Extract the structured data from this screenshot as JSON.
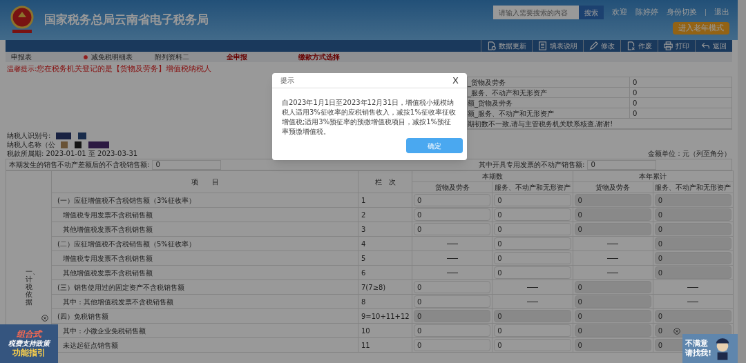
{
  "header": {
    "title": "国家税务总局云南省电子税务局",
    "search": {
      "placeholder": "请输入需要搜索的内容",
      "button": "搜索"
    },
    "links": [
      "欢迎",
      "陈婷婷",
      "身份切换",
      "退出"
    ],
    "elder_mode": "进入老年模式"
  },
  "toolbar": [
    {
      "kind": "refresh",
      "label": "数据更新"
    },
    {
      "kind": "doc",
      "label": "填表说明"
    },
    {
      "kind": "edit",
      "label": "修改"
    },
    {
      "kind": "void",
      "label": "作废"
    },
    {
      "kind": "print",
      "label": "打印"
    },
    {
      "kind": "back",
      "label": "返回"
    }
  ],
  "tabs": [
    {
      "label": "申报表",
      "kind": "plain"
    },
    {
      "label": "减免税明细表",
      "kind": "dot"
    },
    {
      "label": "附列资料二",
      "kind": "plain"
    },
    {
      "label": "全申报",
      "kind": "emphasis"
    },
    {
      "label": "缴款方式选择",
      "kind": "emphasis"
    }
  ],
  "notice": {
    "label": "温馨提示:",
    "text": "您在税务机关登记的是【货物及劳务】增值税纳税人"
  },
  "info_rows": [
    {
      "label": "_货物及劳务",
      "value": "0"
    },
    {
      "label": "_服务、不动产和无形资产",
      "value": "0"
    },
    {
      "label": "额_货物及劳务",
      "value": "0"
    },
    {
      "label": "额_服务、不动产和无形资产",
      "value": "0"
    },
    {
      "label": "期初数不一致,请与主管税务机关联系核查,谢谢!"
    }
  ],
  "taxpayer": {
    "id_label": "纳税人识别号:",
    "name_label": "纳税人名称（公",
    "period_label": "税款所属期:",
    "period": "2023-01-01 至 2023-03-31"
  },
  "unit": "金额单位：元（列至角分）",
  "summary_fields": [
    {
      "label": "本期发生的销售不动产差额后的不含税销售额:",
      "value": "0"
    },
    {
      "label": "其中开具专用发票的不动产销售额:",
      "value": "0"
    }
  ],
  "table": {
    "section": "一、计税依据",
    "item_header": "项　　目",
    "code_header": "栏　次",
    "groups": [
      "本期数",
      "本年累计"
    ],
    "sub_columns": [
      "货物及劳务",
      "服务、不动产和无形资产",
      "货物及劳务",
      "服务、不动产和无形资产"
    ],
    "rows": [
      {
        "item": "(一）应征增值税不含税销售额（3%征收率）",
        "indent": false,
        "code": "1",
        "cells": [
          {
            "kind": "input",
            "value": "0"
          },
          {
            "kind": "input",
            "value": "0"
          },
          {
            "kind": "locked",
            "value": "0"
          },
          {
            "kind": "locked",
            "value": "0"
          }
        ]
      },
      {
        "item": "增值税专用发票不含税销售额",
        "indent": true,
        "code": "2",
        "cells": [
          {
            "kind": "input",
            "value": "0"
          },
          {
            "kind": "input",
            "value": "0"
          },
          {
            "kind": "locked",
            "value": "0"
          },
          {
            "kind": "locked",
            "value": "0"
          }
        ]
      },
      {
        "item": "其他增值税发票不含税销售额",
        "indent": true,
        "code": "3",
        "cells": [
          {
            "kind": "input",
            "value": "0"
          },
          {
            "kind": "input",
            "value": "0"
          },
          {
            "kind": "locked",
            "value": "0"
          },
          {
            "kind": "locked",
            "value": "0"
          }
        ]
      },
      {
        "item": "(二）应征增值税不含税销售额（5%征收率）",
        "indent": false,
        "code": "4",
        "cells": [
          {
            "kind": "dash"
          },
          {
            "kind": "input",
            "value": "0"
          },
          {
            "kind": "dash"
          },
          {
            "kind": "locked",
            "value": "0"
          }
        ]
      },
      {
        "item": "增值税专用发票不含税销售额",
        "indent": true,
        "code": "5",
        "cells": [
          {
            "kind": "dash"
          },
          {
            "kind": "input",
            "value": "0"
          },
          {
            "kind": "dash"
          },
          {
            "kind": "locked",
            "value": "0"
          }
        ]
      },
      {
        "item": "其他增值税发票不含税销售额",
        "indent": true,
        "code": "6",
        "cells": [
          {
            "kind": "dash"
          },
          {
            "kind": "input",
            "value": "0"
          },
          {
            "kind": "dash"
          },
          {
            "kind": "locked",
            "value": "0"
          }
        ]
      },
      {
        "item": "(三）销售使用过的固定资产不含税销售额",
        "indent": false,
        "code": "7(7≥8)",
        "cells": [
          {
            "kind": "input",
            "value": "0"
          },
          {
            "kind": "dash"
          },
          {
            "kind": "locked",
            "value": "0"
          },
          {
            "kind": "dash"
          }
        ]
      },
      {
        "item": "其中：其他增值税发票不含税销售额",
        "indent": true,
        "code": "8",
        "cells": [
          {
            "kind": "input",
            "value": "0"
          },
          {
            "kind": "dash"
          },
          {
            "kind": "locked",
            "value": "0"
          },
          {
            "kind": "dash"
          }
        ]
      },
      {
        "item": "(四）免税销售额",
        "indent": false,
        "code": "9=10+11+12",
        "cells": [
          {
            "kind": "locked",
            "value": "0"
          },
          {
            "kind": "locked",
            "value": "0"
          },
          {
            "kind": "locked",
            "value": "0"
          },
          {
            "kind": "locked",
            "value": "0"
          }
        ]
      },
      {
        "item": "其中：小微企业免税销售额",
        "indent": true,
        "code": "10",
        "cells": [
          {
            "kind": "input",
            "value": "0"
          },
          {
            "kind": "input",
            "value": "0"
          },
          {
            "kind": "locked",
            "value": "0"
          },
          {
            "kind": "locked",
            "value": "0"
          }
        ]
      },
      {
        "item": "未达起征点销售额",
        "indent": true,
        "code": "11",
        "cells": [
          {
            "kind": "input",
            "value": "0"
          },
          {
            "kind": "input",
            "value": "0"
          },
          {
            "kind": "locked",
            "value": "0"
          },
          {
            "kind": "locked",
            "value": "0"
          }
        ]
      }
    ]
  },
  "promo": {
    "lines": [
      "组合式",
      "税费支持政策",
      "功能指引"
    ]
  },
  "feedback": {
    "lines": [
      "不满意",
      "请找我!"
    ]
  },
  "modal": {
    "title": "提示",
    "close": "X",
    "body": "自2023年1月1日至2023年12月31日，增值税小规模纳税人适用3%征收率的应税销售收入，减按1%征收率征收增值税;适用3%预征率的预缴增值税项目，减按1%预征率预缴增值税。",
    "button": "确定"
  }
}
